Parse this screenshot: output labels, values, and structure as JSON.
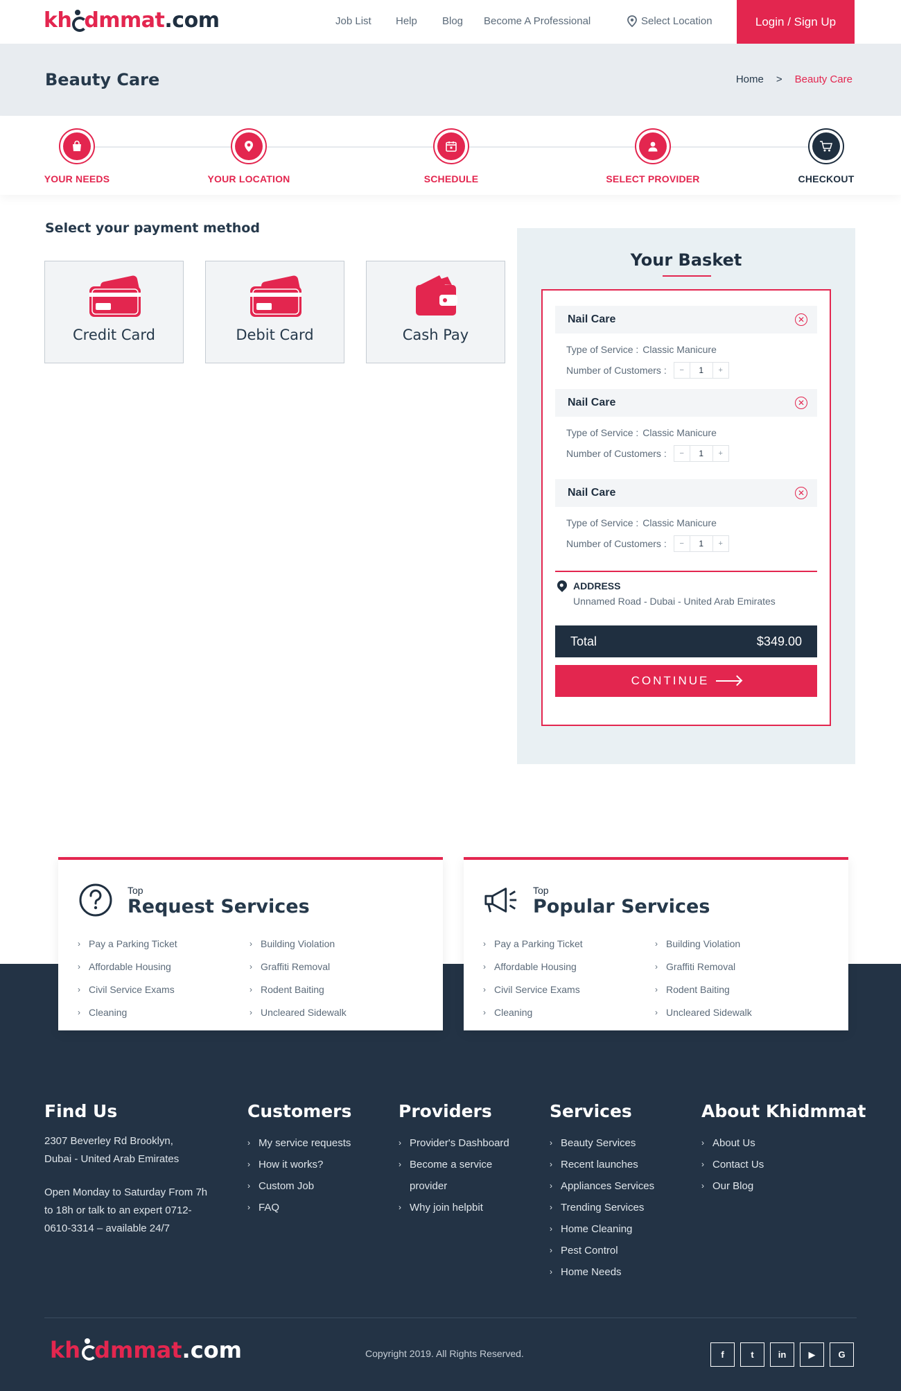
{
  "header": {
    "logo": {
      "kh": "kh",
      "rest": "dmmat",
      "dot": ".com"
    },
    "nav": {
      "job_list": "Job List",
      "help": "Help",
      "blog": "Blog",
      "become": "Become A Professional",
      "location": "Select Location"
    },
    "login": "Login / Sign Up"
  },
  "title_band": {
    "title": "Beauty Care",
    "breadcrumb": {
      "home": "Home",
      "sep": ">",
      "current": "Beauty Care"
    }
  },
  "steps": [
    {
      "label": "YOUR NEEDS",
      "icon": "shopping-bag-icon"
    },
    {
      "label": "YOUR LOCATION",
      "icon": "location-pin-icon"
    },
    {
      "label": "SCHEDULE",
      "icon": "calendar-icon"
    },
    {
      "label": "SELECT PROVIDER",
      "icon": "user-icon"
    },
    {
      "label": "CHECKOUT",
      "icon": "cart-icon"
    }
  ],
  "payment": {
    "title": "Select your payment method",
    "methods": [
      {
        "label": "Credit Card",
        "icon": "credit-card-icon"
      },
      {
        "label": "Debit Card",
        "icon": "debit-card-icon"
      },
      {
        "label": "Cash Pay",
        "icon": "wallet-icon"
      }
    ]
  },
  "basket": {
    "title": "Your Basket",
    "items": [
      {
        "name": "Nail Care",
        "type_label": "Type of Service :",
        "type_value": "Classic Manicure",
        "customers_label": "Number of Customers :",
        "qty": "1",
        "minus": "−",
        "plus": "+"
      },
      {
        "name": "Nail Care",
        "type_label": "Type of Service :",
        "type_value": "Classic Manicure",
        "customers_label": "Number of Customers :",
        "qty": "1",
        "minus": "−",
        "plus": "+"
      },
      {
        "name": "Nail Care",
        "type_label": "Type of Service :",
        "type_value": "Classic Manicure",
        "customers_label": "Number of Customers :",
        "qty": "1",
        "minus": "−",
        "plus": "+"
      }
    ],
    "address_label": "ADDRESS",
    "address": "Unnamed Road - Dubai - United Arab Emirates",
    "total_label": "Total",
    "total_value": "$349.00",
    "continue": "CONTINUE"
  },
  "services": {
    "request": {
      "top": "Top",
      "title": "Request Services",
      "col1": [
        "Pay a Parking Ticket",
        "Affordable Housing",
        "Civil Service Exams",
        "Cleaning"
      ],
      "col2": [
        "Building Violation",
        "Graffiti Removal",
        "Rodent Baiting",
        "Uncleared Sidewalk"
      ]
    },
    "popular": {
      "top": "Top",
      "title": "Popular Services",
      "col1": [
        "Pay a Parking Ticket",
        "Affordable Housing",
        "Civil Service Exams",
        "Cleaning"
      ],
      "col2": [
        "Building Violation",
        "Graffiti Removal",
        "Rodent Baiting",
        "Uncleared Sidewalk"
      ]
    }
  },
  "footer": {
    "find_us": {
      "title": "Find Us",
      "address": "2307 Beverley Rd Brooklyn, Dubai - United Arab Emirates",
      "hours": "Open Monday to Saturday From 7h to 18h or talk to an expert 0712-0610-3314 – available 24/7"
    },
    "customers": {
      "title": "Customers",
      "links": [
        "My service requests",
        "How it works?",
        "Custom Job",
        "FAQ"
      ]
    },
    "providers": {
      "title": "Providers",
      "links": [
        "Provider's Dashboard",
        "Become a service provider",
        "Why join helpbit"
      ]
    },
    "services": {
      "title": "Services",
      "links": [
        "Beauty Services",
        "Recent launches",
        "Appliances Services",
        "Trending Services",
        "Home Cleaning",
        "Pest Control",
        "Home Needs"
      ]
    },
    "about": {
      "title": "About Khidmmat",
      "links": [
        "About Us",
        "Contact Us",
        "Our Blog"
      ]
    },
    "copyright": "Copyright 2019. All Rights Reserved.",
    "socials": [
      {
        "label": "f",
        "icon": "facebook-icon"
      },
      {
        "label": "t",
        "icon": "twitter-icon"
      },
      {
        "label": "in",
        "icon": "linkedin-icon"
      },
      {
        "label": "▶",
        "icon": "youtube-icon"
      },
      {
        "label": "G",
        "icon": "google-icon"
      }
    ]
  },
  "colors": {
    "brand": "#e3264f",
    "dark": "#1f2f40",
    "footer_bg": "#233345"
  }
}
